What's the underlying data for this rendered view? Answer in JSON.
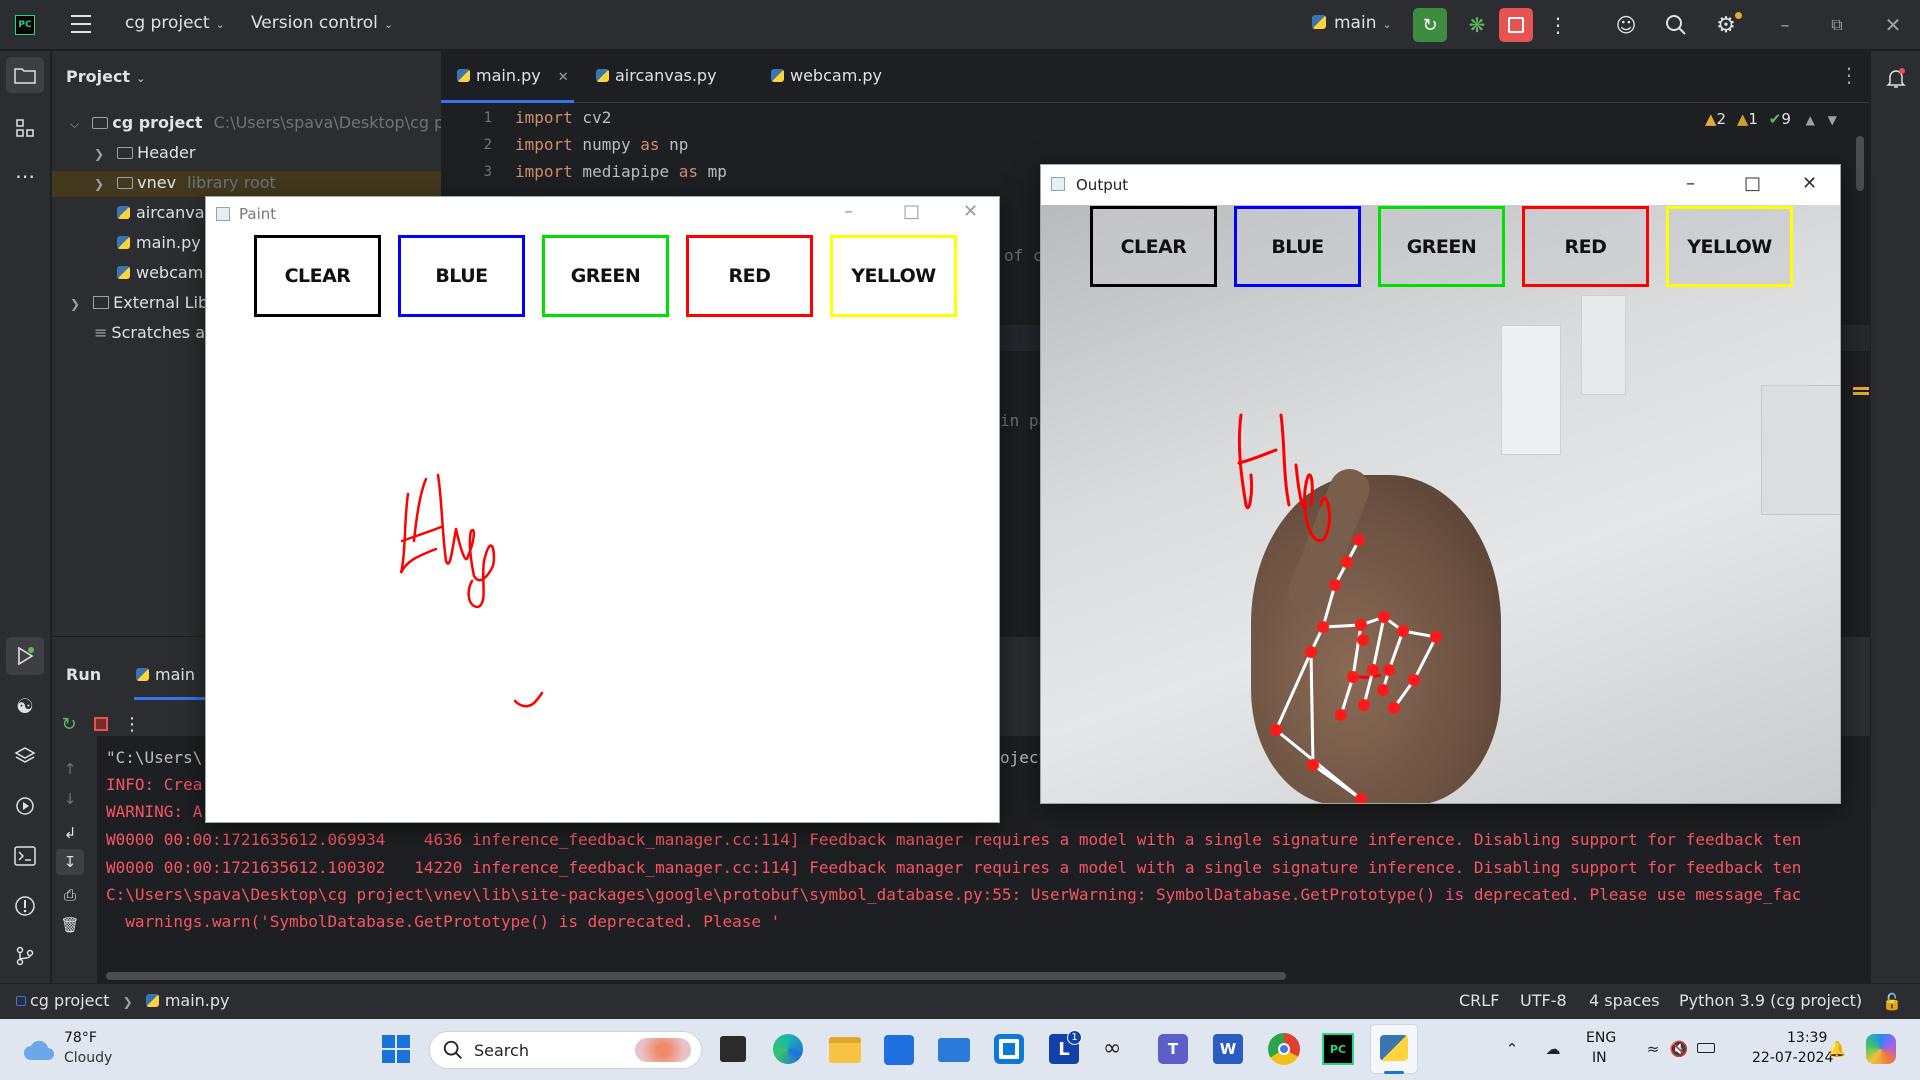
{
  "titlebar": {
    "project": "cg project",
    "vcs": "Version control",
    "branch": "main"
  },
  "project_panel": {
    "title": "Project",
    "root_name": "cg project",
    "root_path": "C:\\Users\\spava\\Desktop\\cg p",
    "items": [
      {
        "label": "Header",
        "extra": ""
      },
      {
        "label": "vnev",
        "extra": "library root"
      },
      {
        "label": "aircanva",
        "extra": ""
      },
      {
        "label": "main.py",
        "extra": ""
      },
      {
        "label": "webcam",
        "extra": ""
      },
      {
        "label": "External Lib",
        "extra": ""
      },
      {
        "label": "Scratches a",
        "extra": ""
      }
    ]
  },
  "editor": {
    "tabs": [
      "main.py",
      "aircanvas.py",
      "webcam.py"
    ],
    "lines": [
      {
        "num": "1",
        "kw": "import",
        "rest": " cv2",
        "kw2": "",
        "rest2": ""
      },
      {
        "num": "2",
        "kw": "import",
        "rest": " numpy ",
        "kw2": "as",
        "rest2": " np"
      },
      {
        "num": "3",
        "kw": "import",
        "rest": " mediapipe ",
        "kw2": "as",
        "rest2": " mp"
      }
    ],
    "fragments": [
      "of c",
      "in pa",
      "oject"
    ],
    "inspections": {
      "warn_a": "2",
      "warn_b": "1",
      "ok": "9"
    }
  },
  "run_panel": {
    "title": "Run",
    "config": "main",
    "console": [
      {
        "text": "\"C:\\Users\\",
        "color": "#bcbec4"
      },
      {
        "text": "INFO: Crea",
        "color": "#f75464"
      },
      {
        "text": "WARNING: A",
        "color": "#f75464"
      },
      {
        "text": "W0000 00:00:1721635612.069934    4636 inference_feedback_manager.cc:114] Feedback manager requires a model with a single signature inference. Disabling support for feedback ten",
        "color": "#f75464"
      },
      {
        "text": "W0000 00:00:1721635612.100302   14220 inference_feedback_manager.cc:114] Feedback manager requires a model with a single signature inference. Disabling support for feedback ten",
        "color": "#f75464"
      },
      {
        "text": "C:\\Users\\spava\\Desktop\\cg project\\vnev\\lib\\site-packages\\google\\protobuf\\symbol_database.py:55: UserWarning: SymbolDatabase.GetPrototype() is deprecated. Please use message_fac",
        "color": "#f75464"
      },
      {
        "text": "  warnings.warn('SymbolDatabase.GetPrototype() is deprecated. Please '",
        "color": "#f75464"
      }
    ]
  },
  "statusbar": {
    "crumb_project": "cg project",
    "crumb_file": "main.py",
    "line_sep": "CRLF",
    "encoding": "UTF-8",
    "indent": "4 spaces",
    "interpreter": "Python 3.9 (cg project)"
  },
  "paint_window": {
    "title": "Paint",
    "buttons": [
      {
        "label": "CLEAR",
        "color": "#000000"
      },
      {
        "label": "BLUE",
        "color": "#0000ff"
      },
      {
        "label": "GREEN",
        "color": "#00e000"
      },
      {
        "label": "RED",
        "color": "#ff0000"
      },
      {
        "label": "YELLOW",
        "color": "#ffff00"
      }
    ]
  },
  "output_window": {
    "title": "Output",
    "buttons": [
      {
        "label": "CLEAR",
        "color": "#000000"
      },
      {
        "label": "BLUE",
        "color": "#0000ff"
      },
      {
        "label": "GREEN",
        "color": "#00e000"
      },
      {
        "label": "RED",
        "color": "#ff0000"
      },
      {
        "label": "YELLOW",
        "color": "#ffff00"
      }
    ]
  },
  "taskbar": {
    "temp": "78°F",
    "weather": "Cloudy",
    "search_placeholder": "Search",
    "lang_top": "ENG",
    "lang_bottom": "IN",
    "time": "13:39",
    "date": "22-07-2024",
    "word_badge": "1"
  },
  "colors": {
    "accent": "#3574f0",
    "run_green": "#4caf50",
    "stop_red": "#e55353"
  }
}
